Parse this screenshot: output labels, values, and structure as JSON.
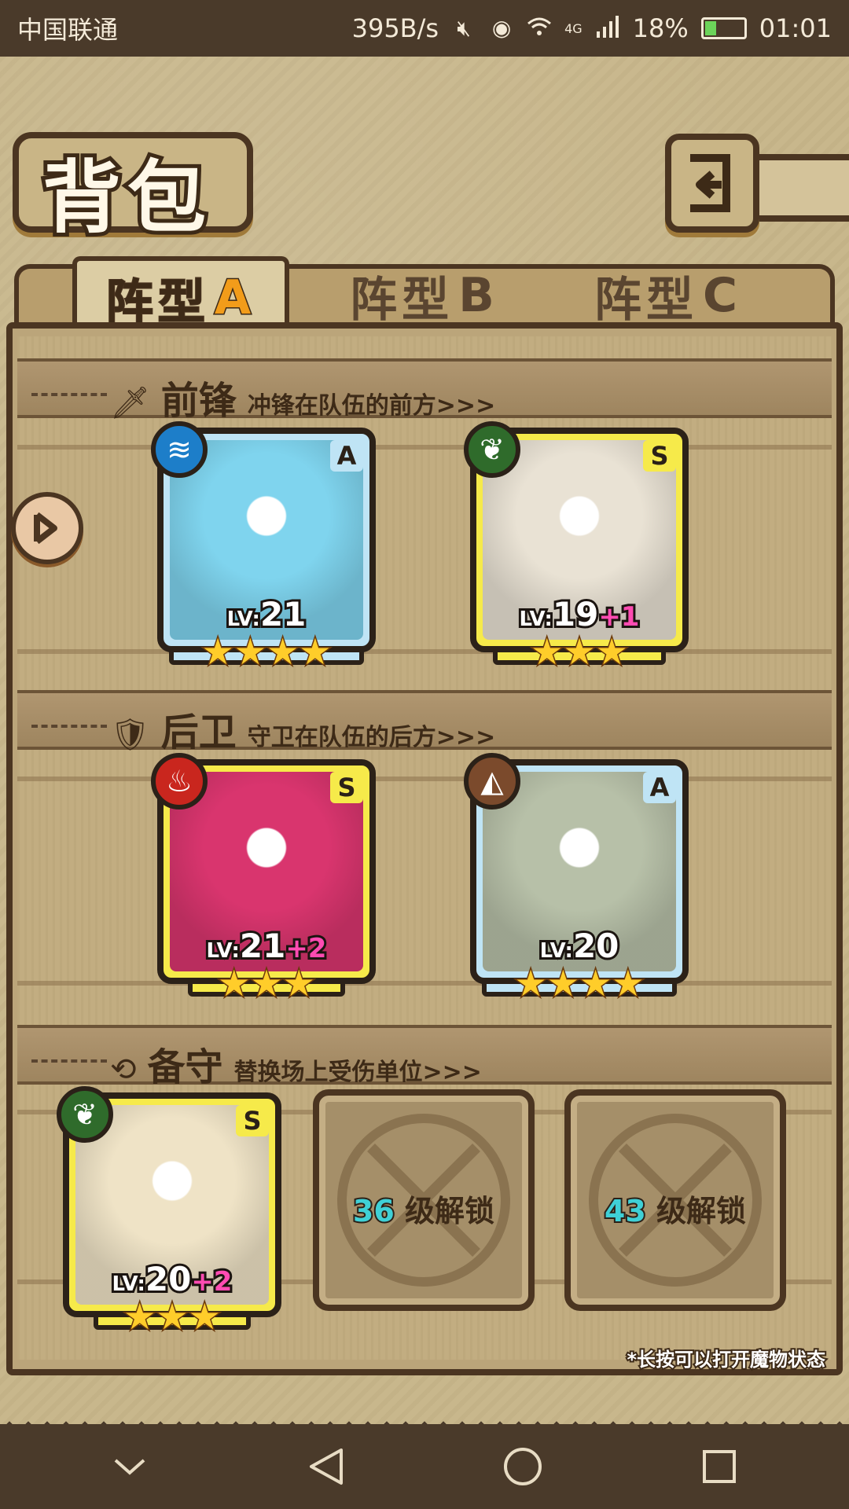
{
  "status_bar": {
    "carrier": "中国联通",
    "speed": "395B/s",
    "network": "4G",
    "battery": "18%",
    "time": "01:01"
  },
  "header": {
    "title": "背包",
    "back_icon": "return-arrow-icon"
  },
  "tabs": [
    {
      "label": "阵型",
      "suffix": "A",
      "active": true
    },
    {
      "label": "阵型",
      "suffix": "B",
      "active": false
    },
    {
      "label": "阵型",
      "suffix": "C",
      "active": false
    }
  ],
  "sections": {
    "front": {
      "name": "前锋",
      "desc": "冲锋在队伍的前方>>>",
      "icon": "sword-icon"
    },
    "back": {
      "name": "后卫",
      "desc": "守卫在队伍的后方>>>",
      "icon": "shield-icon"
    },
    "reserve": {
      "name": "备守",
      "desc": "替换场上受伤单位>>>",
      "icon": "swap-icon"
    }
  },
  "monsters": [
    {
      "rank": "A",
      "element": "water",
      "lv_label": "LV:",
      "lv": "21",
      "plus": "",
      "stars": 4,
      "portrait_color": "#7fd4ee"
    },
    {
      "rank": "S",
      "element": "wood",
      "lv_label": "LV:",
      "lv": "19",
      "plus": "+1",
      "stars": 3,
      "portrait_color": "#e9e2d4"
    },
    {
      "rank": "S",
      "element": "fire",
      "lv_label": "LV:",
      "lv": "21",
      "plus": "+2",
      "stars": 3,
      "portrait_color": "#d9356e"
    },
    {
      "rank": "A",
      "element": "earth",
      "lv_label": "LV:",
      "lv": "20",
      "plus": "",
      "stars": 4,
      "portrait_color": "#b7c0a8"
    },
    {
      "rank": "S",
      "element": "wood",
      "lv_label": "LV:",
      "lv": "20",
      "plus": "+2",
      "stars": 3,
      "portrait_color": "#efe3c6"
    }
  ],
  "locked_slots": [
    {
      "level": "36",
      "text": "级解锁"
    },
    {
      "level": "43",
      "text": "级解锁"
    }
  ],
  "hint": "*长按可以打开魔物状态",
  "colors": {
    "parchment": "#c8b78c",
    "frame_dark": "#4b3521",
    "a_rank_frame": "#bfe4f5",
    "s_rank_frame": "#f6ea4a",
    "active_tab_accent": "#f29c1a",
    "plus_level": "#ff4bb2",
    "unlock_level": "#3fd0d6"
  }
}
